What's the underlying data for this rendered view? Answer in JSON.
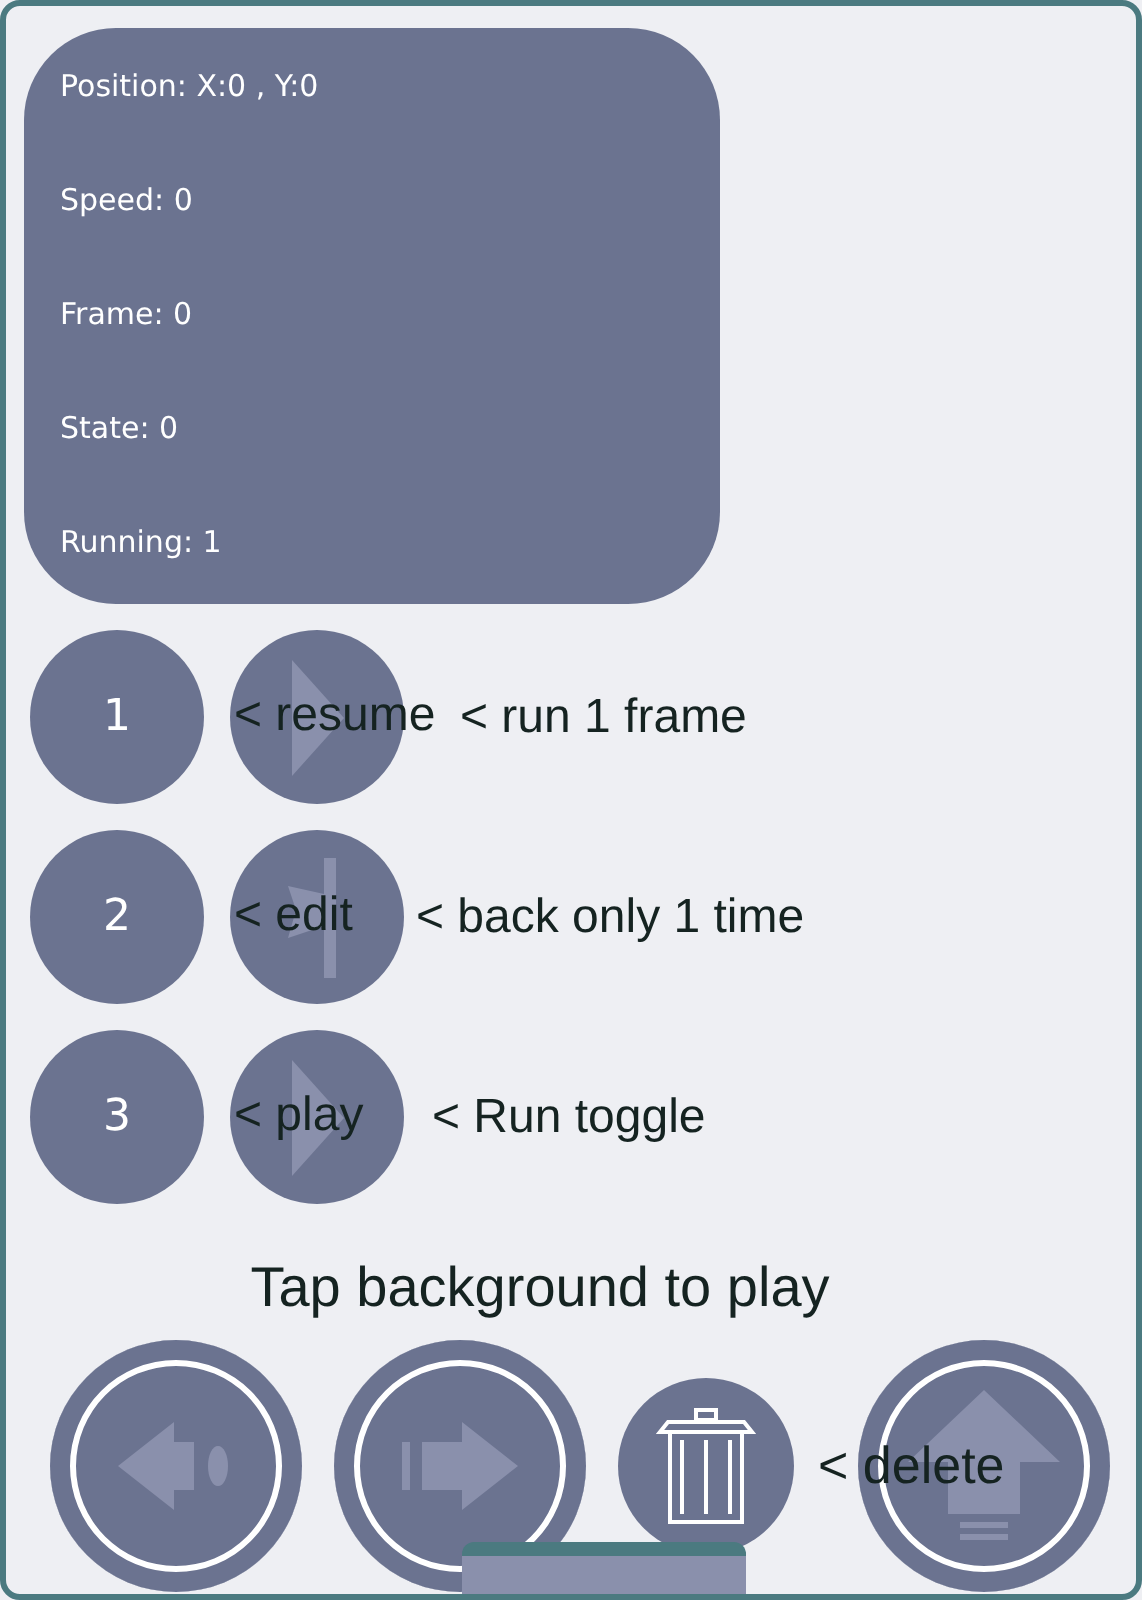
{
  "stats": [
    "Position: X:0 , Y:0",
    "Speed: 0",
    "Frame: 0",
    "State: 0",
    "Running: 1"
  ],
  "rows": [
    {
      "number": "1",
      "kind": "play",
      "label": "< resume",
      "note": "< run 1 frame"
    },
    {
      "number": "2",
      "kind": "edit",
      "label": "< edit",
      "note": "< back only 1 time"
    },
    {
      "number": "3",
      "kind": "play",
      "label": "< play",
      "note": "< Run toggle"
    }
  ],
  "hint": "Tap background to play",
  "controls": [
    {
      "kind": "rewind"
    },
    {
      "kind": "forward"
    },
    {
      "kind": "trash",
      "label": "< delete"
    },
    {
      "kind": "upload"
    }
  ]
}
